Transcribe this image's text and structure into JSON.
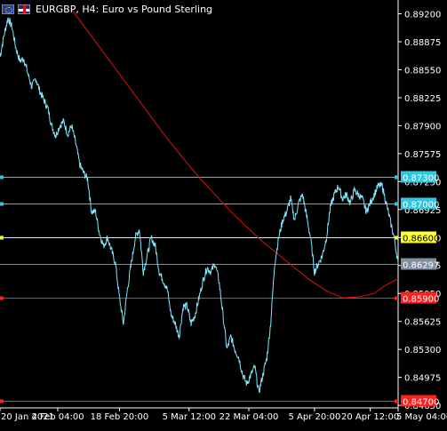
{
  "window": {
    "title": "EURGBP, H4:  Euro vs Pound Sterling",
    "symbol_icon": "eu-flag-icon",
    "currency_icon": "uk-flag-icon"
  },
  "colors": {
    "background": "#000000",
    "price_line": "#7fe8ff",
    "moving_average": "#e01010",
    "cyan_level": "#30c8e0",
    "yellow_level": "#ffff30",
    "gray_level": "#7f8fa0",
    "red_level": "#ff2020",
    "axis_text": "#ffffff"
  },
  "chart_data": {
    "type": "line",
    "title": "EURGBP, H4:  Euro vs Pound Sterling",
    "y_ticks": [
      "0.89200",
      "0.88875",
      "0.88550",
      "0.88225",
      "0.87900",
      "0.87575",
      "0.87250",
      "0.86925",
      "0.86600",
      "0.86275",
      "0.85950",
      "0.85625",
      "0.85300",
      "0.84975",
      "0.84650"
    ],
    "ylim": [
      0.8462,
      0.8936
    ],
    "x_ticks": [
      "20 Jan 2021",
      "4 Feb 04:00",
      "18 Feb 20:00",
      "5 Mar 12:00",
      "22 Mar 04:00",
      "5 Apr 20:00",
      "20 Apr 12:00",
      "5 May 04:00"
    ],
    "horizontal_levels": [
      {
        "label": "0.87300",
        "value": 0.873,
        "color": "cyan"
      },
      {
        "label": "0.87000",
        "value": 0.87,
        "color": "cyan"
      },
      {
        "label": "0.86600",
        "value": 0.866,
        "color": "yellow"
      },
      {
        "label": "0.86297",
        "value": 0.86297,
        "color": "gray",
        "current_price": true
      },
      {
        "label": "0.85900",
        "value": 0.859,
        "color": "red"
      },
      {
        "label": "0.84700",
        "value": 0.847,
        "color": "red"
      }
    ],
    "series": [
      {
        "kind": "price",
        "x": [
          0,
          0.01,
          0.02,
          0.03,
          0.04,
          0.05,
          0.06,
          0.07,
          0.08,
          0.09,
          0.1,
          0.11,
          0.12,
          0.13,
          0.14,
          0.15,
          0.16,
          0.17,
          0.18,
          0.19,
          0.2,
          0.21,
          0.22,
          0.23,
          0.24,
          0.25,
          0.26,
          0.27,
          0.28,
          0.29,
          0.3,
          0.31,
          0.32,
          0.33,
          0.34,
          0.35,
          0.36,
          0.37,
          0.38,
          0.39,
          0.4,
          0.41,
          0.42,
          0.43,
          0.44,
          0.45,
          0.46,
          0.47,
          0.48,
          0.49,
          0.5,
          0.51,
          0.52,
          0.53,
          0.54,
          0.55,
          0.56,
          0.57,
          0.58,
          0.59,
          0.6,
          0.61,
          0.62,
          0.63,
          0.64,
          0.65,
          0.66,
          0.67,
          0.68,
          0.69,
          0.7,
          0.71,
          0.72,
          0.73,
          0.74,
          0.75,
          0.76,
          0.77,
          0.78,
          0.79,
          0.8,
          0.81,
          0.82,
          0.83,
          0.84,
          0.85,
          0.86,
          0.87,
          0.88,
          0.89,
          0.9,
          0.91,
          0.92,
          0.93,
          0.94,
          0.95,
          0.96,
          0.97,
          0.98,
          0.99,
          1.0
        ],
        "y": [
          0.887,
          0.8895,
          0.8915,
          0.8905,
          0.888,
          0.8865,
          0.8868,
          0.885,
          0.8835,
          0.8845,
          0.883,
          0.882,
          0.881,
          0.879,
          0.8778,
          0.879,
          0.8795,
          0.878,
          0.879,
          0.877,
          0.8745,
          0.8735,
          0.8728,
          0.869,
          0.869,
          0.8665,
          0.865,
          0.866,
          0.8645,
          0.863,
          0.859,
          0.856,
          0.86,
          0.863,
          0.866,
          0.867,
          0.862,
          0.864,
          0.866,
          0.865,
          0.862,
          0.861,
          0.86,
          0.857,
          0.856,
          0.8545,
          0.858,
          0.858,
          0.856,
          0.857,
          0.859,
          0.861,
          0.8625,
          0.862,
          0.863,
          0.861,
          0.857,
          0.853,
          0.8545,
          0.853,
          0.852,
          0.85,
          0.849,
          0.85,
          0.851,
          0.848,
          0.85,
          0.852,
          0.856,
          0.863,
          0.866,
          0.868,
          0.869,
          0.8705,
          0.868,
          0.87,
          0.871,
          0.8685,
          0.866,
          0.862,
          0.863,
          0.864,
          0.866,
          0.8695,
          0.871,
          0.872,
          0.8705,
          0.871,
          0.87,
          0.8715,
          0.871,
          0.8705,
          0.869,
          0.87,
          0.871,
          0.872,
          0.872,
          0.87,
          0.868,
          0.866,
          0.863
        ]
      },
      {
        "kind": "moving_average",
        "x": [
          0.18,
          0.22,
          0.26,
          0.3,
          0.34,
          0.38,
          0.42,
          0.46,
          0.5,
          0.54,
          0.58,
          0.62,
          0.66,
          0.7,
          0.74,
          0.78,
          0.82,
          0.86,
          0.9,
          0.94,
          0.97,
          1.0
        ],
        "y": [
          0.8925,
          0.89,
          0.8875,
          0.885,
          0.8825,
          0.88,
          0.8775,
          0.8752,
          0.873,
          0.871,
          0.869,
          0.8672,
          0.8655,
          0.864,
          0.8625,
          0.861,
          0.8598,
          0.859,
          0.8591,
          0.8595,
          0.8605,
          0.8612
        ]
      }
    ]
  }
}
